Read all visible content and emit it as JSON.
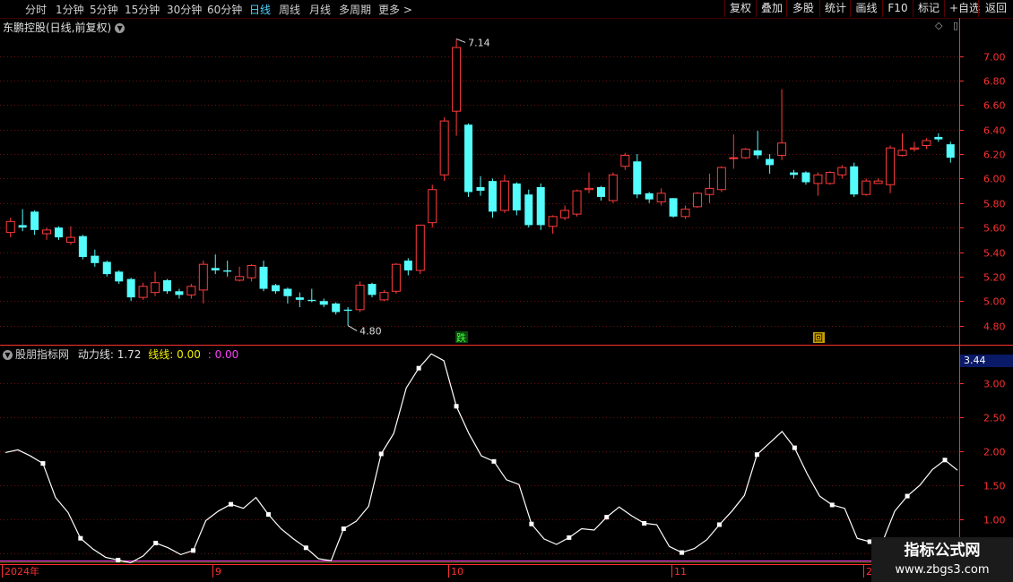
{
  "toolbar": {
    "periods": [
      "分时",
      "1分钟",
      "5分钟",
      "15分钟",
      "30分钟",
      "60分钟",
      "日线",
      "周线",
      "月线",
      "多周期"
    ],
    "active_period": "日线",
    "more_label": "更多",
    "right_buttons": [
      "复权",
      "叠加",
      "多股",
      "统计",
      "画线",
      "F10",
      "标记",
      "+自选",
      "返回"
    ]
  },
  "main_chart": {
    "title": "东鹏控股(日线,前复权)",
    "corner_icons": [
      "◇",
      "▯"
    ],
    "high_label": "7.14",
    "low_label": "4.80",
    "signal_fall": "跌",
    "signal_return": "回"
  },
  "indicator": {
    "name": "股朋指标网",
    "line1_label": "动力线:",
    "line1_value": "1.72",
    "line2_label": "线线:",
    "line2_value": "0.00",
    "line3_label": ":",
    "line3_value": "0.00",
    "badge_value": "3.44"
  },
  "date_axis": {
    "labels": [
      "2024年",
      "9",
      "10",
      "11",
      "2"
    ]
  },
  "watermark": {
    "line1": "指标公式网",
    "line2": "www.zbgs3.com"
  },
  "colors": {
    "up": "#ff3b3b",
    "down": "#54fcfc",
    "line": "#ffffff",
    "grid": "#6a1010",
    "axis": "#ff3030",
    "yellow": "#f0f000",
    "magenta": "#ff40ff"
  },
  "chart_data": [
    {
      "type": "candlestick",
      "y_ticks": [
        4.8,
        5.0,
        5.2,
        5.4,
        5.6,
        5.8,
        6.0,
        6.2,
        6.4,
        6.6,
        6.8,
        7.0
      ],
      "ylim": [
        4.68,
        7.18
      ],
      "grid": true,
      "candles": [
        [
          5.56,
          5.65,
          5.52,
          5.68
        ],
        [
          5.62,
          5.6,
          5.57,
          5.75
        ],
        [
          5.73,
          5.58,
          5.54,
          5.74
        ],
        [
          5.55,
          5.58,
          5.5,
          5.6
        ],
        [
          5.6,
          5.52,
          5.5,
          5.61
        ],
        [
          5.48,
          5.52,
          5.46,
          5.61
        ],
        [
          5.53,
          5.36,
          5.34,
          5.54
        ],
        [
          5.37,
          5.31,
          5.28,
          5.42
        ],
        [
          5.32,
          5.22,
          5.2,
          5.33
        ],
        [
          5.24,
          5.16,
          5.14,
          5.25
        ],
        [
          5.18,
          5.03,
          5.0,
          5.19
        ],
        [
          5.03,
          5.12,
          5.01,
          5.15
        ],
        [
          5.07,
          5.15,
          5.04,
          5.24
        ],
        [
          5.17,
          5.08,
          5.06,
          5.18
        ],
        [
          5.08,
          5.05,
          5.02,
          5.1
        ],
        [
          5.05,
          5.12,
          5.02,
          5.14
        ],
        [
          5.09,
          5.3,
          4.98,
          5.33
        ],
        [
          5.27,
          5.25,
          5.22,
          5.38
        ],
        [
          5.25,
          5.24,
          5.2,
          5.33
        ],
        [
          5.17,
          5.2,
          5.16,
          5.28
        ],
        [
          5.19,
          5.29,
          5.16,
          5.3
        ],
        [
          5.28,
          5.1,
          5.08,
          5.33
        ],
        [
          5.13,
          5.08,
          5.06,
          5.14
        ],
        [
          5.1,
          5.04,
          4.98,
          5.11
        ],
        [
          5.03,
          5.01,
          4.95,
          5.07
        ],
        [
          5.01,
          5.0,
          4.99,
          5.1
        ],
        [
          5.0,
          4.97,
          4.95,
          5.02
        ],
        [
          4.98,
          4.91,
          4.89,
          4.99
        ],
        [
          4.93,
          4.92,
          4.8,
          4.95
        ],
        [
          4.93,
          5.13,
          4.91,
          5.16
        ],
        [
          5.14,
          5.05,
          5.03,
          5.15
        ],
        [
          5.01,
          5.07,
          5.0,
          5.09
        ],
        [
          5.08,
          5.3,
          5.06,
          5.31
        ],
        [
          5.33,
          5.25,
          5.21,
          5.35
        ],
        [
          5.25,
          5.62,
          5.22,
          5.62
        ],
        [
          5.64,
          5.91,
          5.6,
          5.95
        ],
        [
          6.03,
          6.47,
          5.98,
          6.5
        ],
        [
          6.55,
          7.07,
          6.35,
          7.14
        ],
        [
          6.44,
          5.89,
          5.85,
          6.45
        ],
        [
          5.93,
          5.9,
          5.86,
          6.02
        ],
        [
          5.98,
          5.73,
          5.68,
          6.0
        ],
        [
          5.74,
          5.98,
          5.72,
          6.03
        ],
        [
          5.96,
          5.74,
          5.7,
          5.97
        ],
        [
          5.87,
          5.62,
          5.6,
          5.91
        ],
        [
          5.93,
          5.62,
          5.58,
          5.96
        ],
        [
          5.61,
          5.69,
          5.55,
          5.7
        ],
        [
          5.68,
          5.74,
          5.66,
          5.78
        ],
        [
          5.71,
          5.9,
          5.69,
          5.91
        ],
        [
          5.91,
          5.92,
          5.88,
          6.05
        ],
        [
          5.93,
          5.85,
          5.82,
          5.94
        ],
        [
          5.82,
          6.03,
          5.8,
          6.05
        ],
        [
          6.1,
          6.19,
          6.07,
          6.21
        ],
        [
          6.14,
          5.87,
          5.84,
          6.2
        ],
        [
          5.88,
          5.83,
          5.8,
          5.89
        ],
        [
          5.81,
          5.88,
          5.78,
          5.92
        ],
        [
          5.84,
          5.69,
          5.68,
          5.84
        ],
        [
          5.69,
          5.75,
          5.67,
          5.78
        ],
        [
          5.77,
          5.88,
          5.76,
          5.89
        ],
        [
          5.87,
          5.92,
          5.8,
          6.04
        ],
        [
          5.91,
          6.09,
          5.89,
          6.1
        ],
        [
          6.17,
          6.17,
          6.08,
          6.36
        ],
        [
          6.17,
          6.24,
          6.16,
          6.25
        ],
        [
          6.23,
          6.19,
          6.16,
          6.39
        ],
        [
          6.16,
          6.11,
          6.04,
          6.2
        ],
        [
          6.19,
          6.29,
          6.15,
          6.73
        ],
        [
          6.05,
          6.03,
          6.0,
          6.07
        ],
        [
          6.05,
          5.97,
          5.95,
          6.06
        ],
        [
          5.96,
          6.03,
          5.86,
          6.05
        ],
        [
          5.96,
          6.05,
          5.95,
          6.06
        ],
        [
          6.03,
          6.09,
          6.0,
          6.11
        ],
        [
          6.1,
          5.87,
          5.85,
          6.13
        ],
        [
          5.87,
          5.98,
          5.86,
          6.0
        ],
        [
          5.96,
          5.98,
          5.96,
          6.0
        ],
        [
          5.95,
          6.25,
          5.88,
          6.27
        ],
        [
          6.19,
          6.23,
          6.18,
          6.37
        ],
        [
          6.24,
          6.25,
          6.22,
          6.3
        ],
        [
          6.27,
          6.31,
          6.24,
          6.33
        ],
        [
          6.34,
          6.32,
          6.3,
          6.37
        ],
        [
          6.28,
          6.17,
          6.13,
          6.3
        ]
      ]
    },
    {
      "type": "line",
      "name": "动力线",
      "y_ticks": [
        0.5,
        1.0,
        1.5,
        2.0,
        2.5,
        3.0
      ],
      "ylim": [
        0.38,
        3.42
      ],
      "values": [
        1.98,
        2.02,
        1.93,
        1.82,
        1.32,
        1.1,
        0.72,
        0.56,
        0.44,
        0.4,
        0.36,
        0.46,
        0.65,
        0.58,
        0.48,
        0.54,
        0.98,
        1.12,
        1.22,
        1.16,
        1.32,
        1.07,
        0.86,
        0.71,
        0.58,
        0.42,
        0.39,
        0.86,
        0.97,
        1.19,
        1.96,
        2.26,
        2.93,
        3.22,
        3.43,
        3.33,
        2.66,
        2.26,
        1.93,
        1.85,
        1.58,
        1.51,
        0.93,
        0.71,
        0.63,
        0.73,
        0.86,
        0.84,
        1.03,
        1.18,
        1.05,
        0.94,
        0.92,
        0.6,
        0.51,
        0.57,
        0.7,
        0.92,
        1.12,
        1.35,
        1.95,
        2.12,
        2.29,
        2.05,
        1.67,
        1.34,
        1.21,
        1.16,
        0.72,
        0.67,
        0.66,
        1.12,
        1.34,
        1.5,
        1.73,
        1.87,
        1.72
      ],
      "marked_indices": [
        3,
        6,
        9,
        12,
        15,
        18,
        21,
        24,
        27,
        30,
        33,
        36,
        39,
        42,
        45,
        48,
        51,
        54,
        57,
        60,
        63,
        66,
        69,
        72,
        75
      ]
    }
  ]
}
